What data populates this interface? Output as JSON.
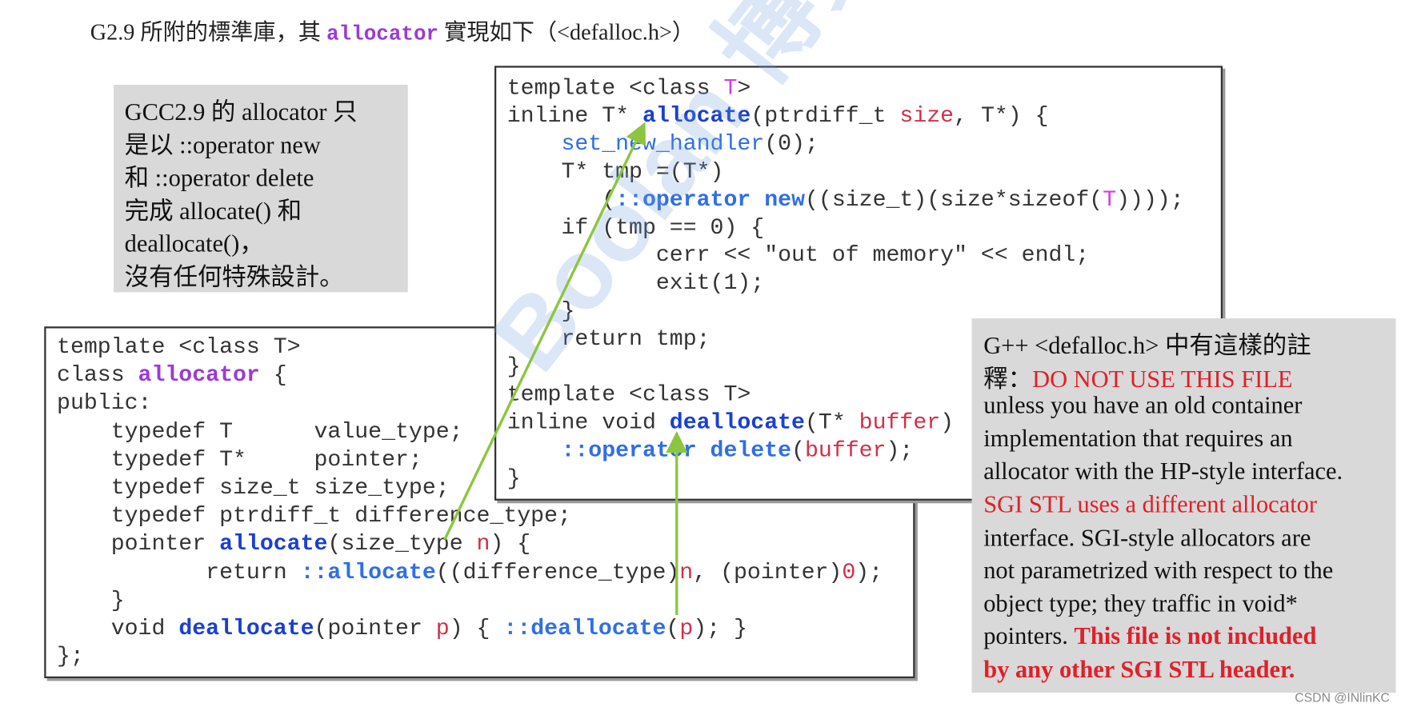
{
  "title": {
    "prefix": "G2.9 所附的標準庫，其 ",
    "keyword": "allocator",
    "suffix": " 實現如下（<defalloc.h>）"
  },
  "note_left": {
    "lines": [
      "GCC2.9 的 allocator 只",
      "是以 ::operator new",
      "和 ::operator delete",
      "完成 allocate() 和",
      "deallocate()，",
      "沒有任何特殊設計。"
    ]
  },
  "code_top": {
    "lines": [
      [
        [
          "template <class ",
          ""
        ],
        [
          "T",
          "c-mag"
        ],
        [
          ">",
          ""
        ]
      ],
      [
        [
          "inline T* ",
          ""
        ],
        [
          "allocate",
          "c-kw"
        ],
        [
          "(ptrdiff_t ",
          ""
        ],
        [
          "size",
          "c-red"
        ],
        [
          ", T*) {",
          ""
        ]
      ],
      [
        [
          "    ",
          ""
        ],
        [
          "set_new_handler",
          "c-lb"
        ],
        [
          "(0);",
          ""
        ]
      ],
      [
        [
          "    T* tmp =(T*)",
          ""
        ]
      ],
      [
        [
          "       (",
          ""
        ],
        [
          "::operator new",
          "c-lbb"
        ],
        [
          "((size_t)(size*sizeof(",
          ""
        ],
        [
          "T",
          "c-mag"
        ],
        [
          "))));",
          ""
        ]
      ],
      [
        [
          "    if (tmp == 0) {",
          ""
        ]
      ],
      [
        [
          "           cerr << \"out of memory\" << endl;",
          ""
        ]
      ],
      [
        [
          "           exit(1);",
          ""
        ]
      ],
      [
        [
          "    }",
          ""
        ]
      ],
      [
        [
          "    return tmp;",
          ""
        ]
      ],
      [
        [
          "}",
          ""
        ]
      ],
      [
        [
          "template <class T>",
          ""
        ]
      ],
      [
        [
          "inline void ",
          ""
        ],
        [
          "deallocate",
          "c-kw"
        ],
        [
          "(T* ",
          ""
        ],
        [
          "buffer",
          "c-red"
        ],
        [
          ")",
          ""
        ]
      ],
      [
        [
          "    ",
          ""
        ],
        [
          "::operator delete",
          "c-lbb"
        ],
        [
          "(",
          ""
        ],
        [
          "buffer",
          "c-red"
        ],
        [
          ");",
          ""
        ]
      ],
      [
        [
          "}",
          ""
        ]
      ]
    ]
  },
  "code_left": {
    "lines": [
      [
        [
          "template <class T>",
          ""
        ]
      ],
      [
        [
          "class ",
          ""
        ],
        [
          "allocator",
          "c-pur"
        ],
        [
          " {",
          ""
        ]
      ],
      [
        [
          "public:",
          ""
        ]
      ],
      [
        [
          "    typedef T      value_type;",
          ""
        ]
      ],
      [
        [
          "    typedef T*     pointer;",
          ""
        ]
      ],
      [
        [
          "    typedef size_t size_type;",
          ""
        ]
      ],
      [
        [
          "    typedef ptrdiff_t difference_type;",
          ""
        ]
      ],
      [
        [
          "    pointer ",
          ""
        ],
        [
          "allocate",
          "c-kw"
        ],
        [
          "(size_type ",
          ""
        ],
        [
          "n",
          "c-red"
        ],
        [
          ") {",
          ""
        ]
      ],
      [
        [
          "           return ",
          ""
        ],
        [
          "::allocate",
          "c-lbb"
        ],
        [
          "((difference_type)",
          ""
        ],
        [
          "n",
          "c-red"
        ],
        [
          ", (pointer)",
          ""
        ],
        [
          "0",
          "c-red"
        ],
        [
          ");",
          ""
        ]
      ],
      [
        [
          "    }",
          ""
        ]
      ],
      [
        [
          "    void ",
          ""
        ],
        [
          "deallocate",
          "c-kw"
        ],
        [
          "(pointer ",
          ""
        ],
        [
          "p",
          "c-red"
        ],
        [
          ") { ",
          ""
        ],
        [
          "::deallocate",
          "c-lbb"
        ],
        [
          "(",
          ""
        ],
        [
          "p",
          "c-red"
        ],
        [
          "); }",
          ""
        ]
      ],
      [
        [
          "};",
          ""
        ]
      ]
    ]
  },
  "note_right": {
    "lines": [
      [
        [
          "G++ <defalloc.h> 中有這樣的註",
          ""
        ]
      ],
      [
        [
          "釋：",
          ""
        ],
        [
          "DO NOT USE THIS FILE",
          "red"
        ]
      ],
      [
        [
          "unless you have an old container",
          ""
        ]
      ],
      [
        [
          "implementation that requires an",
          ""
        ]
      ],
      [
        [
          "allocator with the HP-style interface.",
          ""
        ]
      ],
      [
        [
          "SGI STL uses a different allocator",
          "red"
        ]
      ],
      [
        [
          "interface.  SGI-style allocators are",
          ""
        ]
      ],
      [
        [
          "not parametrized with respect to the",
          ""
        ]
      ],
      [
        [
          "object type; they traffic in void*",
          ""
        ]
      ],
      [
        [
          "pointers.  ",
          ""
        ],
        [
          "This file is not included",
          "redb"
        ]
      ],
      [
        [
          "by any other SGI STL header.",
          "redb"
        ],
        [
          ".",
          ""
        ]
      ]
    ]
  },
  "watermark": "Boolan 博览网",
  "credit": "CSDN @INlinKC",
  "colors": {
    "arrow": "#8cc63f",
    "keyword_blue": "#1a3fd1",
    "purple": "#9a3bd6",
    "red": "#e0202a",
    "note_bg": "#d9d9d9"
  }
}
